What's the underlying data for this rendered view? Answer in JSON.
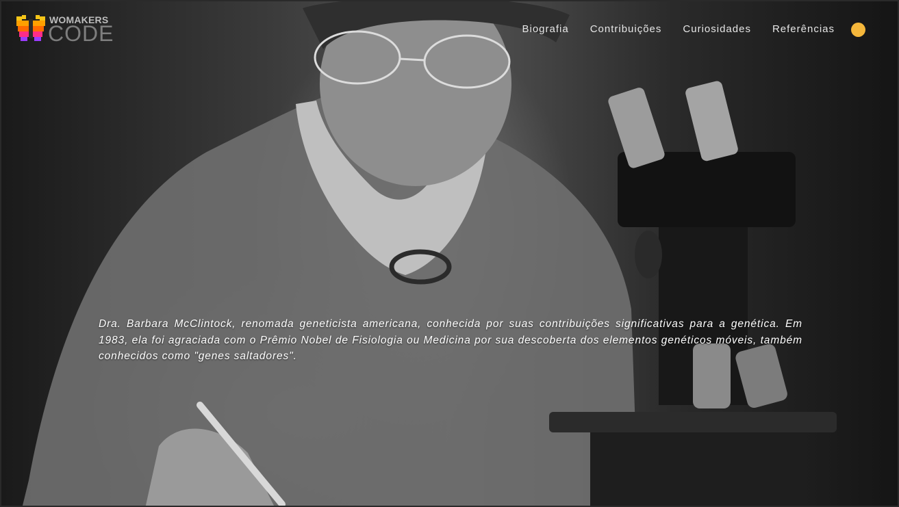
{
  "brand": {
    "top": "WOMAKERS",
    "bottom": "CODE",
    "icon": "butterfly-logo-icon",
    "colors": [
      "#f5c518",
      "#ff6a00",
      "#ff2d87",
      "#9b3cff"
    ]
  },
  "nav": {
    "links": [
      "Biografia",
      "Contribuições",
      "Curiosidades",
      "Referências"
    ],
    "theme_toggle": {
      "icon": "theme-toggle-icon",
      "color": "#f5b73b"
    }
  },
  "hero": {
    "intro": "Dra. Barbara McClintock, renomada geneticista americana, conhecida por suas contribuições significativas para a genética. Em 1983, ela foi agraciada com o Prêmio Nobel de Fisiologia ou Medicina por sua descoberta dos elementos genéticos móveis, também conhecidos como \"genes saltadores\"."
  }
}
